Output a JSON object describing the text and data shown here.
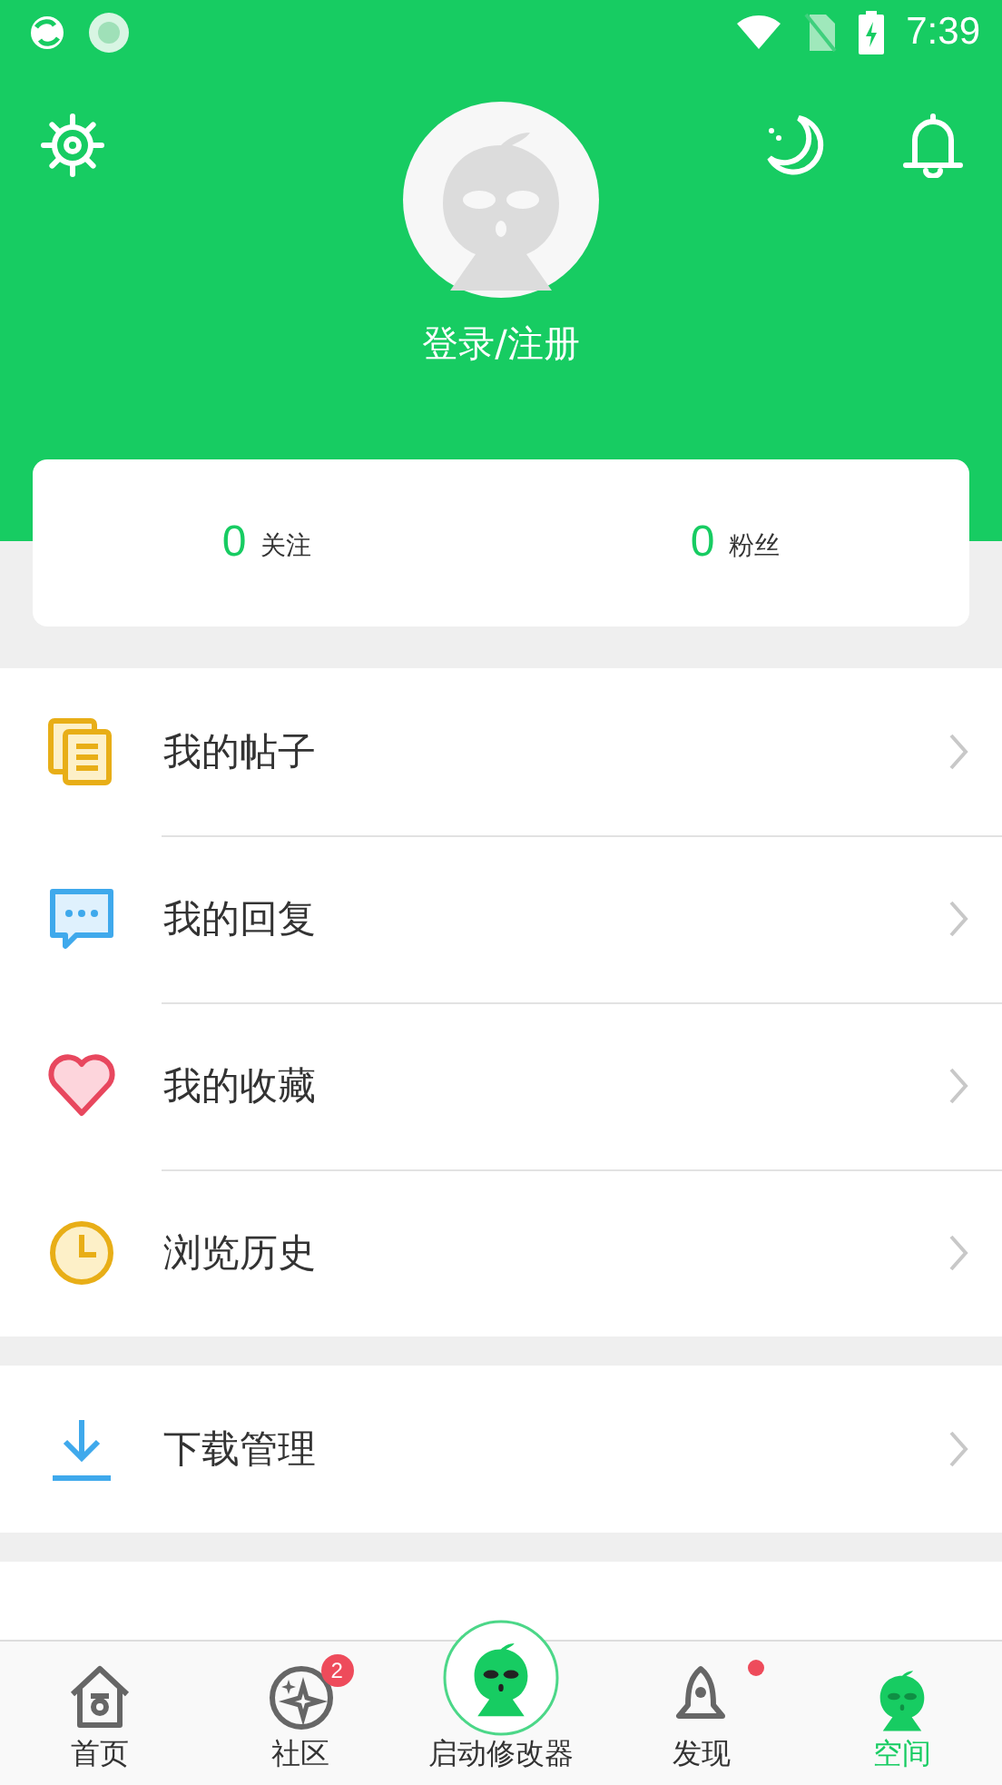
{
  "status_bar": {
    "time": "7:39"
  },
  "profile": {
    "login_text": "登录/注册"
  },
  "stats": [
    {
      "value": "0",
      "label": "关注"
    },
    {
      "value": "0",
      "label": "粉丝"
    }
  ],
  "menu_groups": [
    [
      {
        "label": "我的帖子"
      },
      {
        "label": "我的回复"
      },
      {
        "label": "我的收藏"
      },
      {
        "label": "浏览历史"
      }
    ],
    [
      {
        "label": "下载管理"
      }
    ]
  ],
  "bottom_nav": [
    {
      "label": "首页",
      "selected": false
    },
    {
      "label": "社区",
      "selected": false,
      "badge": "2"
    },
    {
      "label": "启动修改器",
      "selected": false,
      "kind": "center"
    },
    {
      "label": "发现",
      "selected": false,
      "dot": true
    },
    {
      "label": "空间",
      "selected": true
    }
  ]
}
